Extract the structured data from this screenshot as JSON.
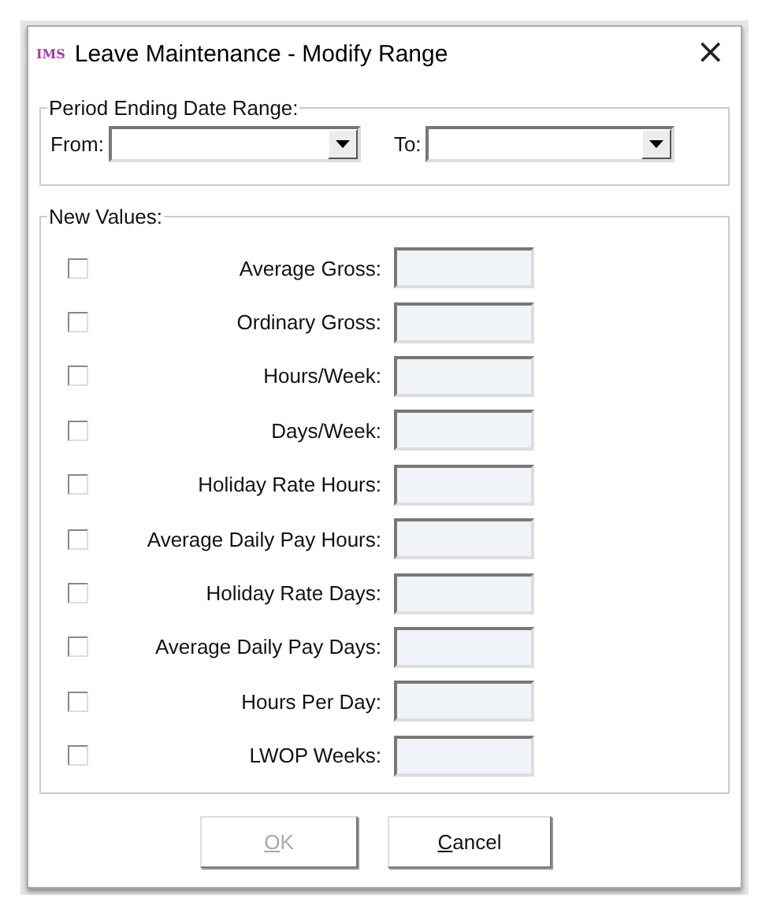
{
  "window": {
    "icon_text": "IMS",
    "title": "Leave Maintenance - Modify Range",
    "close": "×"
  },
  "date_range": {
    "legend": "Period Ending Date Range:",
    "from_label": "From:",
    "to_label": "To:"
  },
  "new_values": {
    "legend": "New Values:",
    "rows": [
      {
        "label": "Average Gross:",
        "checked": false
      },
      {
        "label": "Ordinary Gross:",
        "checked": false
      },
      {
        "label": "Hours/Week:",
        "checked": false
      },
      {
        "label": "Days/Week:",
        "checked": false
      },
      {
        "label": "Holiday Rate Hours:",
        "checked": false
      },
      {
        "label": "Average Daily Pay Hours:",
        "checked": false
      },
      {
        "label": "Holiday Rate Days:",
        "checked": false
      },
      {
        "label": "Average Daily Pay Days:",
        "checked": false
      },
      {
        "label": "Hours Per Day:",
        "checked": false
      },
      {
        "label": "LWOP Weeks:",
        "checked": false
      }
    ]
  },
  "buttons": [
    {
      "label": "OK",
      "first_letter_underlined": true,
      "disabled": true
    },
    {
      "label": "Cancel",
      "first_letter_underlined": true,
      "disabled": false
    }
  ]
}
